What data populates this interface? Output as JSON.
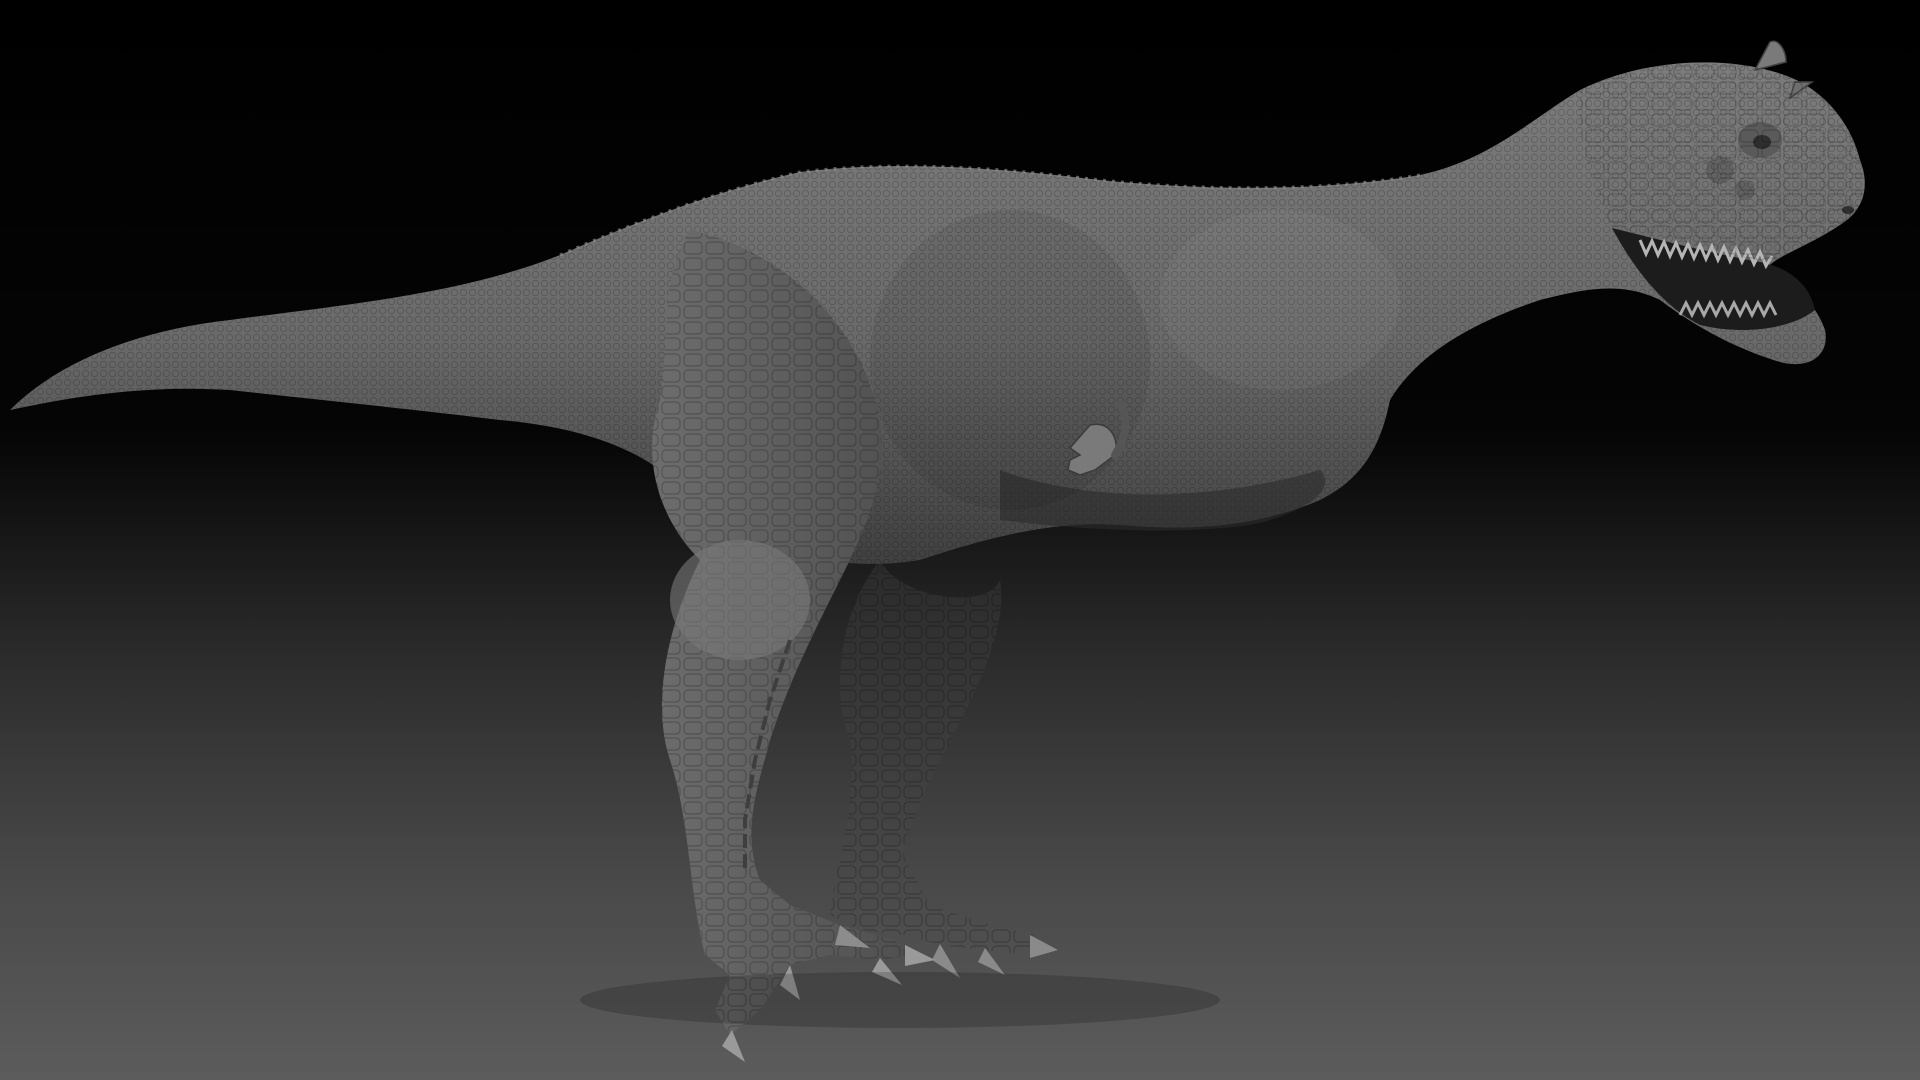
{
  "scene": {
    "subject": "dinosaur-sculpt",
    "colors": {
      "background_top": "#000000",
      "background_bottom": "#5c5c5c",
      "skin": "#6e6e6e",
      "skin_shadow": "#3a3a3a",
      "skin_highlight": "#8c8c8c",
      "teeth": "#b5b5b5"
    }
  }
}
